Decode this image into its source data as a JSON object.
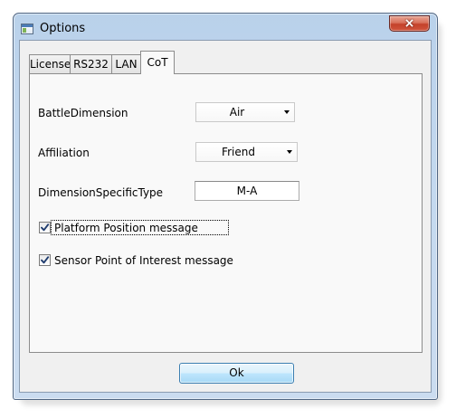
{
  "window": {
    "title": "Options",
    "close_glyph": "×"
  },
  "tabs": [
    {
      "label": "License",
      "active": false
    },
    {
      "label": "RS232",
      "active": false
    },
    {
      "label": "LAN",
      "active": false
    },
    {
      "label": "CoT",
      "active": true
    }
  ],
  "cot": {
    "battle_dimension": {
      "label": "BattleDimension",
      "value": "Air"
    },
    "affiliation": {
      "label": "Affiliation",
      "value": "Friend"
    },
    "dimension_specific_type": {
      "label": "DimensionSpecificType",
      "value": "M-A"
    },
    "platform_position": {
      "label": "Platform Position message",
      "checked": true
    },
    "sensor_poi": {
      "label": "Sensor Point of Interest message",
      "checked": true
    }
  },
  "footer": {
    "ok_label": "Ok"
  },
  "icons": {
    "window_icon": "window-app-icon",
    "close": "close-icon",
    "dropdown": "chevron-down-icon",
    "check": "checkmark-icon"
  },
  "colors": {
    "titlebar": "#b9d1ea",
    "close_button": "#c4412a",
    "client_bg": "#f0f0f0",
    "tab_panel_bg": "#f9f9f9",
    "ok_button": "#bee6fd",
    "checkmark": "#1f3c6e"
  }
}
